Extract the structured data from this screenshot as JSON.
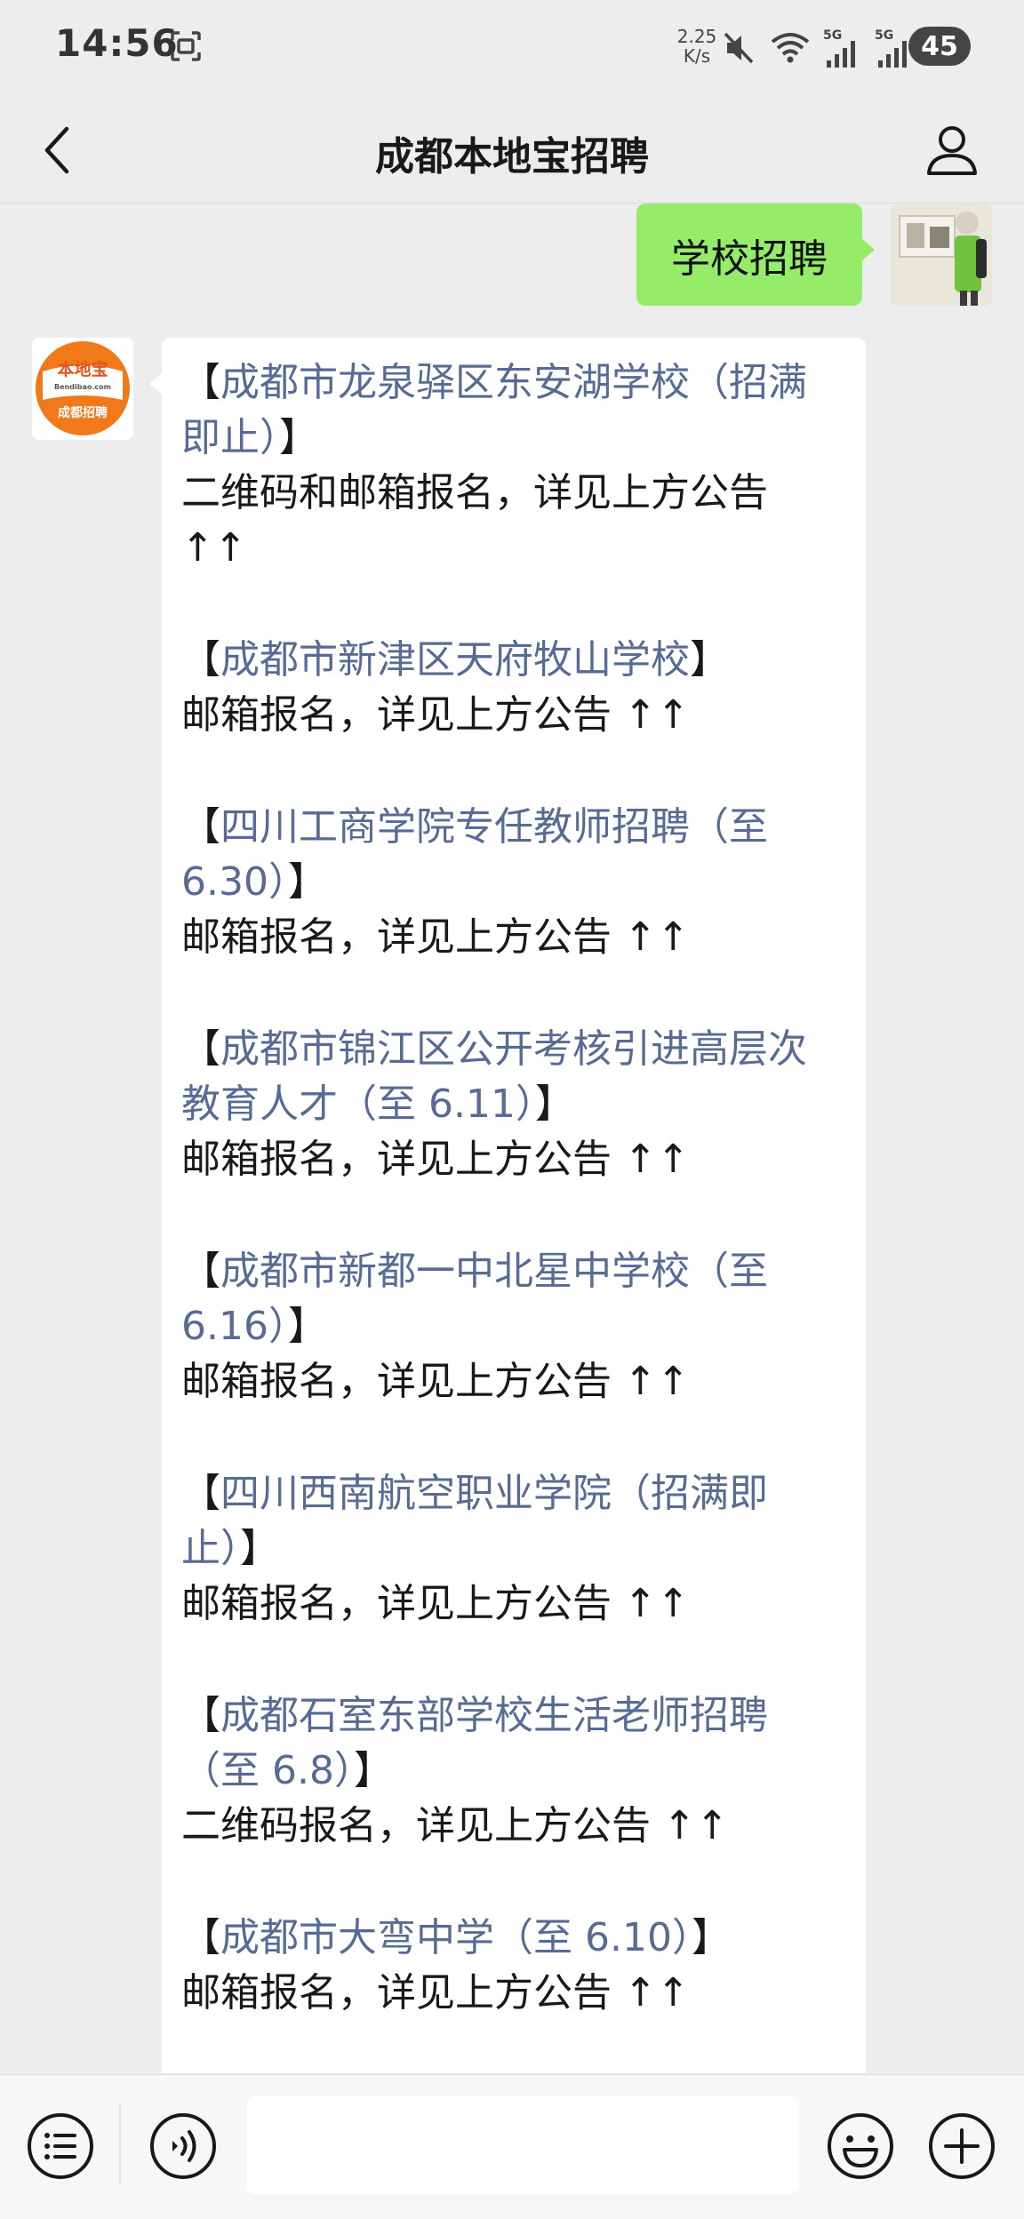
{
  "status_bar": {
    "time": "14:56",
    "net_speed_value": "2.25",
    "net_speed_unit": "K/s",
    "signal_1_label": "5G",
    "signal_2_label": "5G",
    "battery": "45"
  },
  "header": {
    "title": "成都本地宝招聘"
  },
  "messages": {
    "sent_text": "学校招聘",
    "bot_logo_top": "本地宝",
    "bot_logo_domain": "Bendibao.com",
    "bot_logo_bottom": "成都招聘",
    "entries": [
      {
        "open": "【",
        "title": "成都市龙泉驿区东安湖学校（招满即止）",
        "close": "】",
        "desc": "二维码和邮箱报名，详见上方公告 ↑↑"
      },
      {
        "open": "【",
        "title": "成都市新津区天府牧山学校",
        "close": "】",
        "desc": "邮箱报名，详见上方公告 ↑↑"
      },
      {
        "open": "【",
        "title": "四川工商学院专任教师招聘（至 6.30）",
        "close": "】",
        "desc": "邮箱报名，详见上方公告 ↑↑"
      },
      {
        "open": "【",
        "title": "成都市锦江区公开考核引进高层次教育人才（至 6.11）",
        "close": "】",
        "desc": "邮箱报名，详见上方公告 ↑↑"
      },
      {
        "open": "【",
        "title": "成都市新都一中北星中学校（至 6.16）",
        "close": "】",
        "desc": "邮箱报名，详见上方公告 ↑↑"
      },
      {
        "open": "【",
        "title": "四川西南航空职业学院（招满即止）",
        "close": "】",
        "desc": "邮箱报名，详见上方公告 ↑↑"
      },
      {
        "open": "【",
        "title": "成都石室东部学校生活老师招聘（至 6.8）",
        "close": "】",
        "desc": "二维码报名，详见上方公告 ↑↑"
      },
      {
        "open": "【",
        "title": "成都市大弯中学（至 6.10）",
        "close": "】",
        "desc": "邮箱报名，详见上方公告 ↑↑"
      }
    ]
  },
  "input_bar": {
    "value": "",
    "placeholder": ""
  },
  "colors": {
    "link": "#576b95",
    "sent_bubble": "#95ec69",
    "background": "#ededed",
    "logo_orange": "#f07a1a"
  },
  "icons": [
    "screenshot-icon",
    "mute-icon",
    "wifi-icon",
    "signal-icon",
    "back-icon",
    "profile-icon",
    "menu-list-icon",
    "voice-icon",
    "emoji-icon",
    "plus-icon"
  ]
}
